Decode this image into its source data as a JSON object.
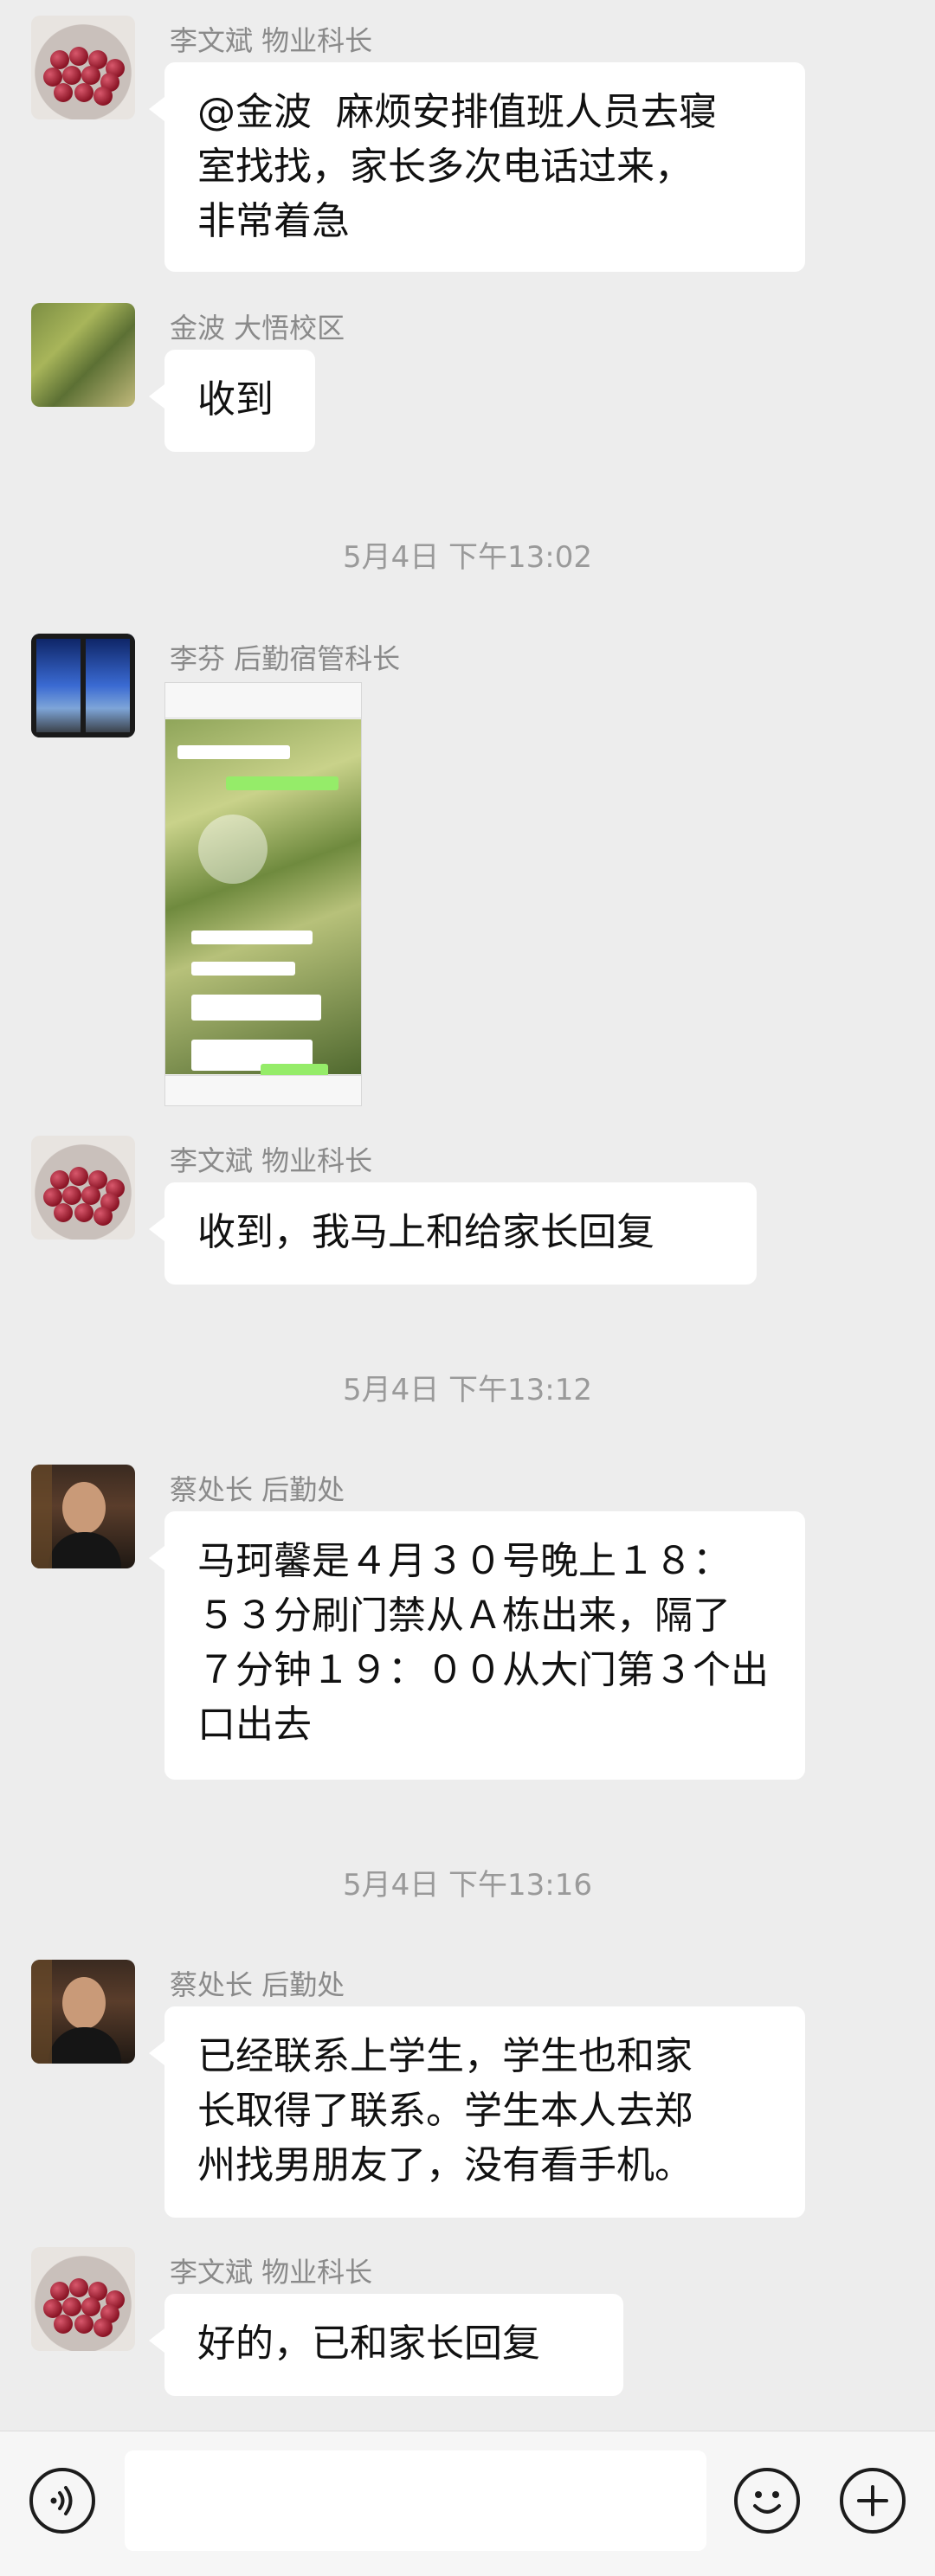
{
  "messages": [
    {
      "sender": "李文斌 物业科长",
      "text": "@金波  麻烦安排值班人员去寝\n室找找，家长多次电话过来，\n非常着急",
      "avatar_icon": "red-dates-avatar-icon"
    },
    {
      "sender": "金波 大悟校区",
      "text": "收到",
      "avatar_icon": "green-plant-avatar-icon"
    },
    {
      "sender": "李芬 后勤宿管科长",
      "type": "image",
      "avatar_icon": "window-view-avatar-icon"
    },
    {
      "sender": "李文斌 物业科长",
      "text": "收到，我马上和给家长回复",
      "avatar_icon": "red-dates-avatar-icon"
    },
    {
      "sender": "蔡处长 后勤处",
      "text": "马珂馨是４月３０号晚上１８：\n５３分刷门禁从Ａ栋出来，隔了\n７分钟１９：００从大门第３个出\n口出去",
      "avatar_icon": "man-avatar-icon"
    },
    {
      "sender": "蔡处长 后勤处",
      "text": "已经联系上学生，学生也和家\n长取得了联系。学生本人去郑\n州找男朋友了，没有看手机。",
      "avatar_icon": "man-avatar-icon"
    },
    {
      "sender": "李文斌 物业科长",
      "text": "好的，已和家长回复",
      "avatar_icon": "red-dates-avatar-icon"
    }
  ],
  "timestamps": [
    "5月4日 下午13:02",
    "5月4日 下午13:12",
    "5月4日 下午13:16"
  ],
  "input_bar": {
    "voice_icon": "voice-icon",
    "emoji_icon": "emoji-icon",
    "add_icon": "add-icon"
  },
  "colors": {
    "background": "#ededed",
    "bubble": "#ffffff",
    "bar": "#f6f6f6"
  }
}
